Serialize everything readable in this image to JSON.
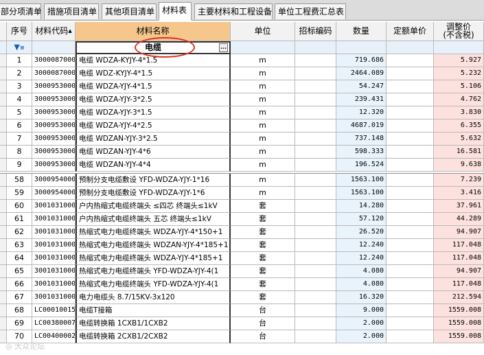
{
  "tabs": [
    {
      "label": "部分项清单"
    },
    {
      "label": "措施项目清单"
    },
    {
      "label": "其他项目清单"
    },
    {
      "label": "材料表"
    },
    {
      "label": "主要材料和工程设备"
    },
    {
      "label": "单位工程费汇总表"
    }
  ],
  "columns": {
    "seq": "序号",
    "code": "材料代码",
    "name": "材料名称",
    "unit": "单位",
    "bid_code": "招标编码",
    "qty": "数量",
    "quota_price": "定额单价",
    "adj_price_1": "调整价",
    "adj_price_2": "(不含税)"
  },
  "filter": {
    "name_value": "电缆",
    "ellipsis": "..."
  },
  "rows": [
    {
      "seq": "1",
      "code": "3000087000",
      "name": "电缆 WDZA-KYJY-4*1.5",
      "unit": "m",
      "qty": "719.686",
      "adj": "5.927"
    },
    {
      "seq": "2",
      "code": "3000087000",
      "name": "电缆 WDZ-KYJY-4*1.5",
      "unit": "m",
      "qty": "2464.089",
      "adj": "5.232"
    },
    {
      "seq": "3",
      "code": "3000953000",
      "name": "电缆 WDZA-YJY-4*1.5",
      "unit": "m",
      "qty": "54.247",
      "adj": "5.106"
    },
    {
      "seq": "4",
      "code": "3000953000",
      "name": "电缆 WDZA-YJY-3*2.5",
      "unit": "m",
      "qty": "239.431",
      "adj": "4.762"
    },
    {
      "seq": "5",
      "code": "3000953000",
      "name": "电缆 WDZA-YJY-3*1.5",
      "unit": "m",
      "qty": "12.320",
      "adj": "3.830"
    },
    {
      "seq": "6",
      "code": "3000953000",
      "name": "电缆 WDZA-YJY-4*2.5",
      "unit": "m",
      "qty": "4687.019",
      "adj": "6.355"
    },
    {
      "seq": "7",
      "code": "3000953000",
      "name": "电缆 WDZAN-YJY-3*2.5",
      "unit": "m",
      "qty": "737.148",
      "adj": "5.632"
    },
    {
      "seq": "8",
      "code": "3000953000",
      "name": "电缆 WDZAN-YJY-4*6",
      "unit": "m",
      "qty": "598.333",
      "adj": "16.581"
    },
    {
      "seq": "9",
      "code": "3000953000",
      "name": "电缆 WDZAN-YJY-4*4",
      "unit": "m",
      "qty": "196.524",
      "adj": "9.638"
    },
    {
      "seq": "58",
      "code": "3000954000",
      "name": "预制分支电缆敷设 YFD-WDZA-YJY-1*16",
      "unit": "m",
      "qty": "1563.100",
      "adj": "7.239"
    },
    {
      "seq": "59",
      "code": "3000954000",
      "name": "预制分支电缆敷设 YFD-WDZA-YJY-1*6",
      "unit": "m",
      "qty": "1563.100",
      "adj": "3.416"
    },
    {
      "seq": "60",
      "code": "3001031000",
      "name": "户内热缩式电缆终端头 ≤四芯 终端头≤1kV",
      "unit": "套",
      "qty": "14.280",
      "adj": "37.961"
    },
    {
      "seq": "61",
      "code": "3001031000",
      "name": "户内热缩式电缆终端头 五芯 终端头≤1kV",
      "unit": "套",
      "qty": "57.120",
      "adj": "44.289"
    },
    {
      "seq": "62",
      "code": "3001031000",
      "name": "热缩式电力电缆终端头 WDZA-YJY-4*150+1",
      "unit": "套",
      "qty": "26.520",
      "adj": "94.907"
    },
    {
      "seq": "63",
      "code": "3001031000",
      "name": "热缩式电力电缆终端头 WDZAN-YJY-4*185+1",
      "unit": "套",
      "qty": "12.240",
      "adj": "117.048"
    },
    {
      "seq": "64",
      "code": "3001031000",
      "name": "热缩式电力电缆终端头 WDZA-YJY-4*185+1",
      "unit": "套",
      "qty": "12.240",
      "adj": "117.048"
    },
    {
      "seq": "65",
      "code": "3001031000",
      "name": "热缩式电力电缆终端头 YFD-WDZA-YJY-4(1",
      "unit": "套",
      "qty": "4.080",
      "adj": "94.907"
    },
    {
      "seq": "66",
      "code": "3001031000",
      "name": "热缩式电力电缆终端头 YFD-WDZA-YJY-4(1",
      "unit": "套",
      "qty": "4.080",
      "adj": "117.048"
    },
    {
      "seq": "67",
      "code": "3001031000",
      "name": "电力电缆头 8.7/15KV-3x120",
      "unit": "套",
      "qty": "16.320",
      "adj": "212.594"
    },
    {
      "seq": "68",
      "code": "LC00010015",
      "name": "电缆T接箱",
      "unit": "台",
      "qty": "9.000",
      "adj": "1559.008"
    },
    {
      "seq": "69",
      "code": "LC00380007",
      "name": "电缆转换箱 1CXB1/1CXB2",
      "unit": "台",
      "qty": "2.000",
      "adj": "1559.008"
    },
    {
      "seq": "70",
      "code": "LC00400002",
      "name": "电缆转换箱 2CXB1/2CXB2",
      "unit": "台",
      "qty": "2.000",
      "adj": "1559.008"
    }
  ],
  "colors": {
    "header_highlight": "#f5c78c",
    "qty_bg": "#e9f3fb",
    "adj_bg": "#fde1de",
    "annotation_circle": "#e03020"
  }
}
